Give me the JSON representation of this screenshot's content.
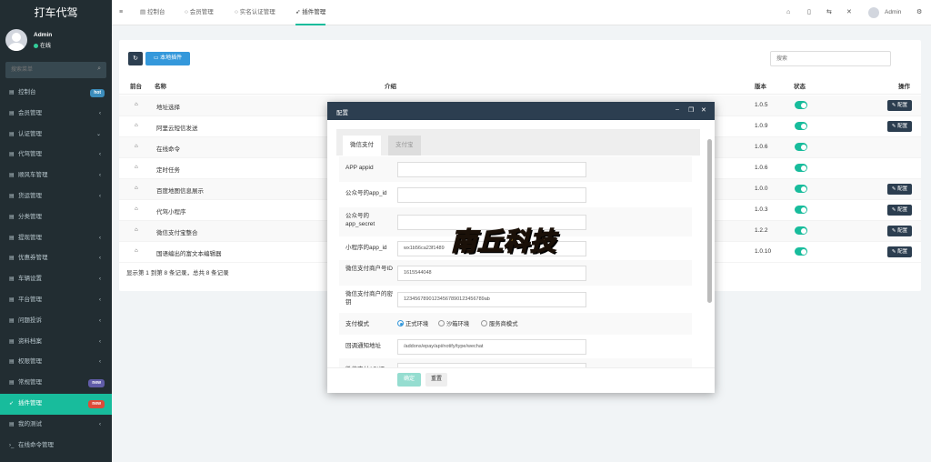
{
  "app": {
    "logo": "打车代驾"
  },
  "user": {
    "name": "Admin",
    "status": "在线"
  },
  "sidebar": {
    "search_placeholder": "搜索菜单",
    "items": [
      {
        "label": "控制台",
        "badge": "hot",
        "badge_color": "#3c8dbc"
      },
      {
        "label": "会员管理",
        "arrow": "‹"
      },
      {
        "label": "认证管理",
        "arrow": "⌄"
      },
      {
        "label": "代驾管理",
        "arrow": "‹"
      },
      {
        "label": "顺风车管理",
        "arrow": "‹"
      },
      {
        "label": "货运管理",
        "arrow": "‹"
      },
      {
        "label": "分类管理"
      },
      {
        "label": "提现管理",
        "arrow": "‹"
      },
      {
        "label": "优惠券管理",
        "arrow": "‹"
      },
      {
        "label": "车辆设置",
        "arrow": "‹"
      },
      {
        "label": "平台管理",
        "arrow": "‹"
      },
      {
        "label": "问题投诉",
        "arrow": "‹"
      },
      {
        "label": "资料档案",
        "arrow": "‹"
      },
      {
        "label": "权限管理",
        "arrow": "‹"
      },
      {
        "label": "常规管理",
        "badge": "new",
        "badge_color": "#605ca8"
      },
      {
        "label": "插件管理",
        "badge": "new",
        "badge_color": "#dd4b39",
        "active": true
      },
      {
        "label": "我的测试",
        "arrow": "‹"
      },
      {
        "label": "在线命令管理"
      }
    ]
  },
  "topbar": {
    "tabs": [
      {
        "label": "控制台",
        "icon": "dashboard-icon"
      },
      {
        "label": "会员管理",
        "icon": "circle-icon"
      },
      {
        "label": "实名认证管理",
        "icon": "circle-icon"
      },
      {
        "label": "插件管理",
        "icon": "rocket-icon",
        "active": true
      }
    ],
    "user_name": "Admin"
  },
  "toolbar": {
    "local_plugin_label": "本地插件",
    "search_placeholder": "搜索"
  },
  "table": {
    "headers": {
      "front": "前台",
      "name": "名称",
      "intro": "介绍",
      "version": "版本",
      "status": "状态",
      "action": "操作"
    },
    "rows": [
      {
        "name": "地址选择",
        "version": "1.0.5",
        "config": true
      },
      {
        "name": "阿里云短信发送",
        "version": "1.0.9",
        "config": true
      },
      {
        "name": "在线命令",
        "version": "1.0.6",
        "config": false
      },
      {
        "name": "定时任务",
        "version": "1.0.6",
        "config": false
      },
      {
        "name": "百度地图信息展示",
        "version": "1.0.0",
        "config": true
      },
      {
        "name": "代驾小程序",
        "version": "1.0.3",
        "config": true
      },
      {
        "name": "微信支付宝整合",
        "version": "1.2.2",
        "config": true
      },
      {
        "name": "国语编出的富文本编辑器",
        "version": "1.0.10",
        "config": true
      }
    ],
    "config_label": "配置",
    "footer": "显示第 1 到第 8 条记录，总共 8 条记录"
  },
  "modal": {
    "title": "配置",
    "tabs": [
      "微信支付",
      "支付宝"
    ],
    "fields": [
      {
        "label": "APP appid",
        "value": ""
      },
      {
        "label": "公众号的app_id",
        "value": ""
      },
      {
        "label": "公众号的app_secret",
        "value": ""
      },
      {
        "label": "小程序的app_id",
        "value": "wx1b56ca23f1489"
      },
      {
        "label": "微信支付商户号ID",
        "value": "1615544048"
      },
      {
        "label": "微信支付商户的密钥",
        "value": "12345678901234567890123456789ab"
      },
      {
        "label": "支付模式",
        "options": [
          "正式环境",
          "沙箱环境",
          "服务商模式"
        ],
        "selected": "正式环境"
      },
      {
        "label": "回调通知地址",
        "value": "/addons/epay/api/notify/type/wechat"
      },
      {
        "label": "微信支付API证",
        "value": "/addons/epay/certs/apiclient_cert.pem"
      }
    ],
    "ok_label": "确定",
    "reset_label": "重置"
  },
  "colors": {
    "sidebar_bg": "#222d32",
    "accent": "#18bc9c",
    "dark": "#2c3e50",
    "blue": "#3498db"
  }
}
